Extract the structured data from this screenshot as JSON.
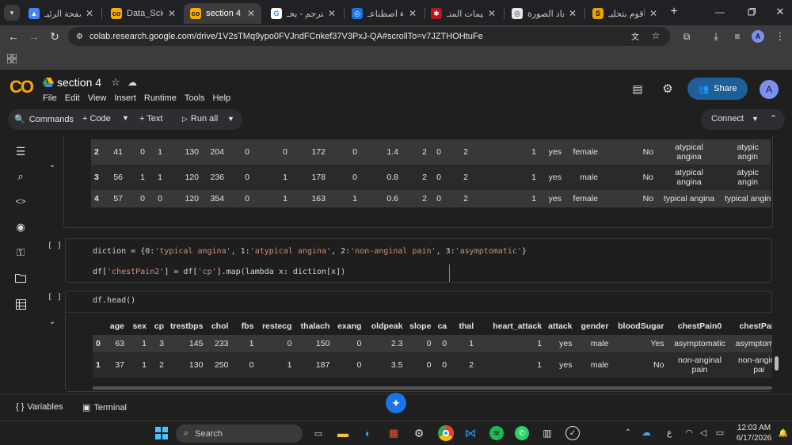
{
  "browser": {
    "tabs": [
      {
        "title": "الصفحة الرئيـ"
      },
      {
        "title": "Data_Science"
      },
      {
        "title": "section 4 - C"
      },
      {
        "title": "المترجم - بحـ"
      },
      {
        "title": "ذكاء اصطناعـ"
      },
      {
        "title": "تعليمات المتـ"
      },
      {
        "title": "أبعاد الصورة"
      },
      {
        "title": "سأقوم بتحليـ"
      }
    ],
    "url": "colab.research.google.com/drive/1V2sTMq9ypo0FVJndFCnkef37V3PxJ-QA#scrollTo=v7JZTHOHtuFe",
    "profile_initial": "A"
  },
  "colab": {
    "logo": "CO",
    "notebook_title": "section 4",
    "menu": [
      "File",
      "Edit",
      "View",
      "Insert",
      "Runtime",
      "Tools",
      "Help"
    ],
    "share_label": "Share",
    "avatar": "A",
    "commands_label": "Commands",
    "code_label": "+ Code",
    "text_label": "+ Text",
    "run_all_label": "Run all",
    "connect_label": "Connect"
  },
  "output1": {
    "rows": [
      {
        "idx": "2",
        "cells": [
          "41",
          "0",
          "1",
          "130",
          "204",
          "0",
          "0",
          "172",
          "0",
          "1.4",
          "2",
          "0",
          "2",
          "1",
          "yes",
          "female",
          "No"
        ],
        "cp0": [
          "atypical",
          "angina"
        ],
        "cp2": [
          "atypic",
          "angin"
        ]
      },
      {
        "idx": "3",
        "cells": [
          "56",
          "1",
          "1",
          "120",
          "236",
          "0",
          "1",
          "178",
          "0",
          "0.8",
          "2",
          "0",
          "2",
          "1",
          "yes",
          "male",
          "No"
        ],
        "cp0": [
          "atypical",
          "angina"
        ],
        "cp2": [
          "atypic",
          "angin"
        ]
      },
      {
        "idx": "4",
        "cells": [
          "57",
          "0",
          "0",
          "120",
          "354",
          "0",
          "1",
          "163",
          "1",
          "0.6",
          "2",
          "0",
          "2",
          "1",
          "yes",
          "female",
          "No"
        ],
        "cp0": [
          "typical angina"
        ],
        "cp2": [
          "typical angin"
        ]
      }
    ]
  },
  "cell2": {
    "bracket": "[ ]",
    "line1_a": "diction = {0:",
    "line1_s0": "'typical angina'",
    "line1_b": ", 1:",
    "line1_s1": "'atypical angina'",
    "line1_c": ", 2:",
    "line1_s2": "'non-anginal pain'",
    "line1_d": ", 3:",
    "line1_s3": "'asymptomatic'",
    "line1_e": "}",
    "line2_a": "df[",
    "line2_s0": "'chestPain2'",
    "line2_b": "] = df[",
    "line2_s1": "'cp'",
    "line2_c": "].map(lambda x: diction[x])"
  },
  "cell3": {
    "bracket": "[ ]",
    "code": "df.head()",
    "headers": [
      "age",
      "sex",
      "cp",
      "trestbps",
      "chol",
      "fbs",
      "restecg",
      "thalach",
      "exang",
      "oldpeak",
      "slope",
      "ca",
      "thal",
      "heart_attack",
      "attack",
      "gender",
      "bloodSugar",
      "chestPain0",
      "chestPain"
    ],
    "rows": [
      {
        "idx": "0",
        "cells": [
          "63",
          "1",
          "3",
          "145",
          "233",
          "1",
          "0",
          "150",
          "0",
          "2.3",
          "0",
          "0",
          "1",
          "1",
          "yes",
          "male",
          "Yes"
        ],
        "cp0": [
          "asymptomatic"
        ],
        "cp2": [
          "asymptomati"
        ]
      },
      {
        "idx": "1",
        "cells": [
          "37",
          "1",
          "2",
          "130",
          "250",
          "0",
          "1",
          "187",
          "0",
          "3.5",
          "0",
          "0",
          "2",
          "1",
          "yes",
          "male",
          "No"
        ],
        "cp0": [
          "non-anginal",
          "pain"
        ],
        "cp2": [
          "non-angina",
          "pai"
        ]
      }
    ]
  },
  "bottom": {
    "variables": "Variables",
    "terminal": "Terminal"
  },
  "taskbar": {
    "search": "Search",
    "time": "12:03 AM",
    "date": "6/17/2026",
    "lang": "ع"
  }
}
